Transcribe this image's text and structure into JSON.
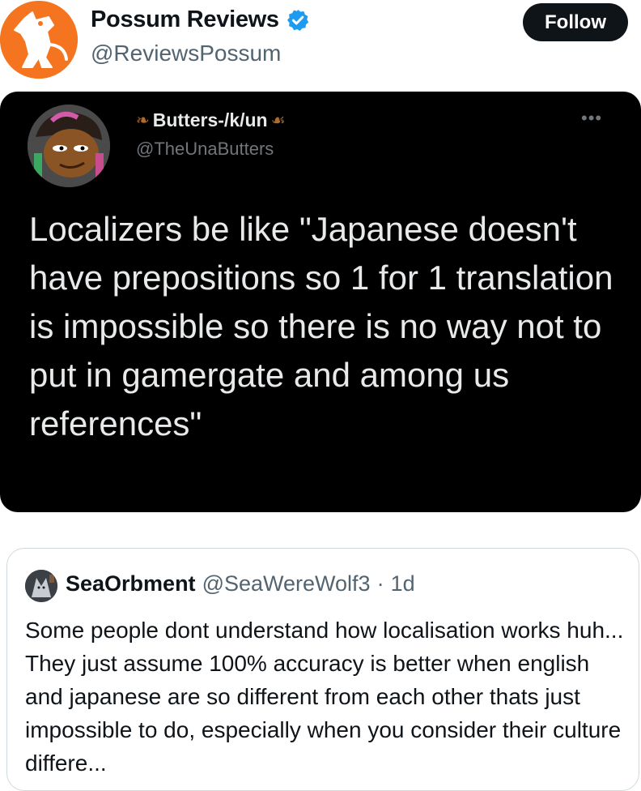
{
  "post": {
    "display_name": "Possum Reviews",
    "handle": "@ReviewsPossum",
    "follow_label": "Follow",
    "verified_icon": "verified-badge-icon",
    "accent": "#1d9bf0"
  },
  "media": {
    "author_name": "Butters-/k/un",
    "author_handle": "@TheUnaButters",
    "more": "•••",
    "text": "Localizers be like \"Japanese doesn't have prepositions so 1 for 1 translation is impossible so there is no way not to put in gamergate and among us references\""
  },
  "quote": {
    "author_name": "SeaOrbment",
    "author_handle": "@SeaWereWolf3",
    "separator": "·",
    "time": "1d",
    "text": "Some people dont understand how localisation works huh... They just assume 100% accuracy is better when english and japanese are so different from each other thats just impossible to do, especially when you consider their culture differe..."
  }
}
